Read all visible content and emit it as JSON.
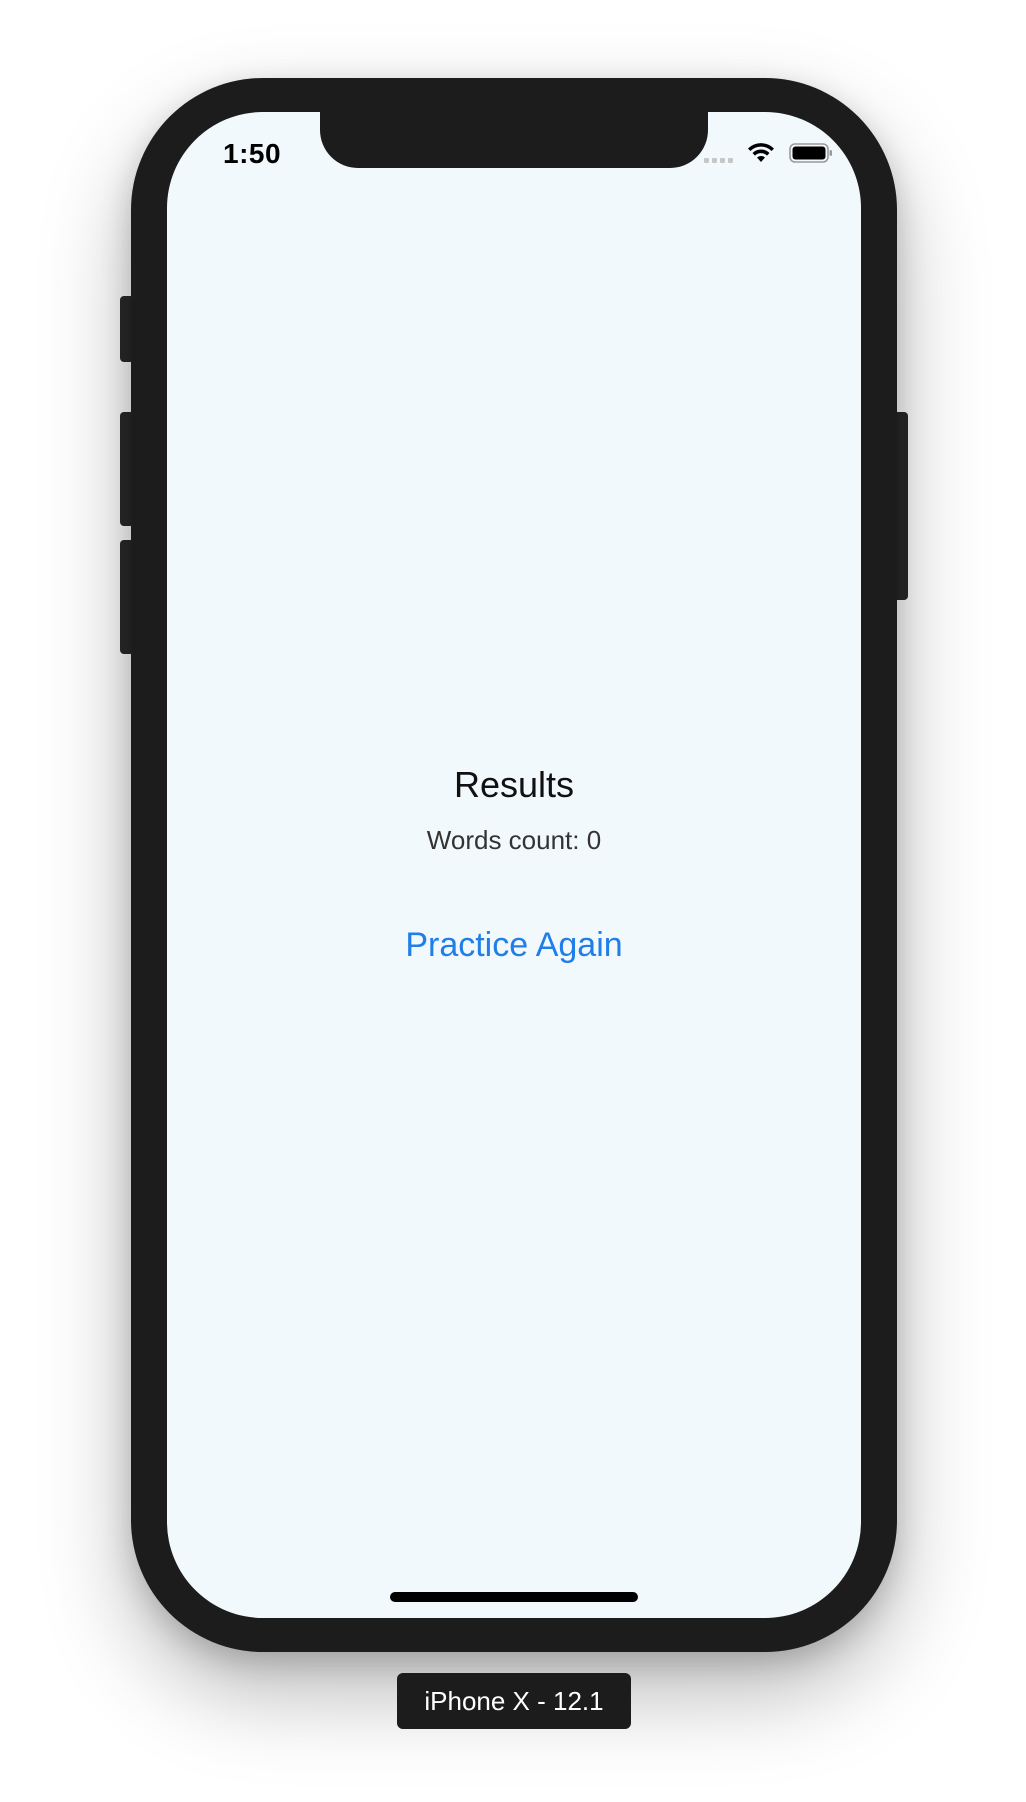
{
  "status_bar": {
    "time": "1:50",
    "icons": [
      "signal-icon",
      "wifi-icon",
      "battery-icon"
    ]
  },
  "results": {
    "title": "Results",
    "words_count": "Words count: 0"
  },
  "actions": {
    "practice_again_label": "Practice Again"
  },
  "device": {
    "label": "iPhone X - 12.1"
  },
  "colors": {
    "background": "#f2f9fd",
    "accent": "#1f7ee8",
    "bezel": "#1c1c1c"
  }
}
